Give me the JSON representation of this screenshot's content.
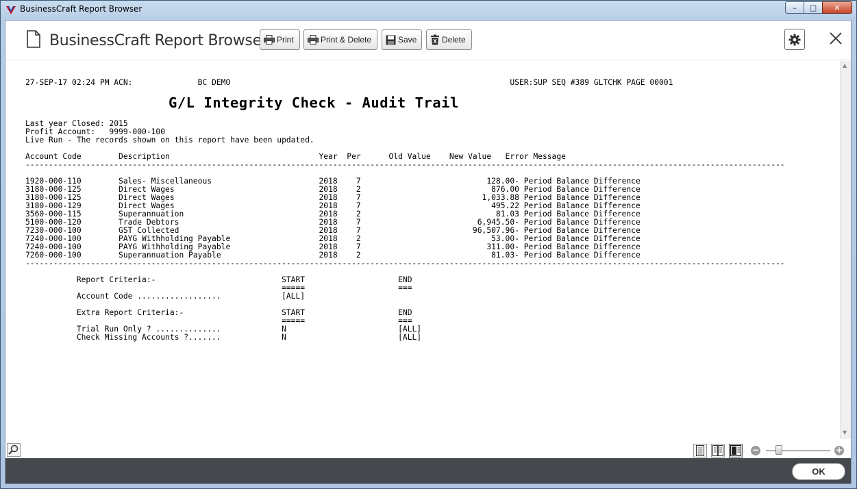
{
  "window": {
    "title": "BusinessCraft Report Browser",
    "minimize": "–",
    "maximize": "□",
    "close": "✕"
  },
  "header": {
    "title": "BusinessCraft Report Browser",
    "buttons": {
      "print": "Print",
      "print_delete": "Print & Delete",
      "save": "Save",
      "delete": "Delete"
    },
    "icons": [
      "document-icon",
      "printer-icon",
      "save-icon",
      "trash-icon",
      "gear-icon",
      "close-icon"
    ]
  },
  "report": {
    "header_line": "27-SEP-17 02:24 PM ACN:              BC DEMO                                                            USER:SUP SEQ #389 GLTCHK PAGE 00001",
    "title": "G/L Integrity Check - Audit Trail",
    "info": [
      "Last year Closed: 2015",
      "Profit Account:   9999-000-100",
      "Live Run - The records shown on this report have been updated."
    ],
    "columns": [
      "Account Code",
      "Description",
      "Year",
      "Per",
      "Old Value",
      "New Value",
      "Error Message"
    ],
    "rows": [
      [
        "1920-000-110",
        "Sales- Miscellaneous",
        "2018",
        "7",
        "",
        "128.00-",
        "Period Balance Difference"
      ],
      [
        "3180-000-125",
        "Direct Wages",
        "2018",
        "2",
        "",
        "876.00",
        "Period Balance Difference"
      ],
      [
        "3180-000-125",
        "Direct Wages",
        "2018",
        "7",
        "",
        "1,033.88",
        "Period Balance Difference"
      ],
      [
        "3180-000-129",
        "Direct Wages",
        "2018",
        "7",
        "",
        "495.22",
        "Period Balance Difference"
      ],
      [
        "3560-000-115",
        "Superannuation",
        "2018",
        "2",
        "",
        "81.03",
        "Period Balance Difference"
      ],
      [
        "5100-000-120",
        "Trade Debtors",
        "2018",
        "7",
        "",
        "6,945.50-",
        "Period Balance Difference"
      ],
      [
        "7230-000-100",
        "GST Collected",
        "2018",
        "7",
        "",
        "96,507.96-",
        "Period Balance Difference"
      ],
      [
        "7240-000-100",
        "PAYG Withholding Payable",
        "2018",
        "2",
        "",
        "53.00-",
        "Period Balance Difference"
      ],
      [
        "7240-000-100",
        "PAYG Withholding Payable",
        "2018",
        "7",
        "",
        "311.00-",
        "Period Balance Difference"
      ],
      [
        "7260-000-100",
        "Superannuation Payable",
        "2018",
        "2",
        "",
        "81.03-",
        "Period Balance Difference"
      ]
    ],
    "criteria": {
      "heading": "Report Criteria:-",
      "start": "START",
      "end": "END",
      "start_ul": "=====",
      "end_ul": "===",
      "items": [
        {
          "label": "Account Code ..................",
          "start": "[ALL]",
          "end": ""
        }
      ]
    },
    "extra_criteria": {
      "heading": "Extra Report Criteria:-",
      "start": "START",
      "end": "END",
      "start_ul": "=====",
      "end_ul": "===",
      "items": [
        {
          "label": "Trial Run Only ? ..............",
          "start": "N",
          "end": "[ALL]"
        },
        {
          "label": "Check Missing Accounts ?.......",
          "start": "N",
          "end": "[ALL]"
        }
      ]
    }
  },
  "footer": {
    "ok": "OK"
  }
}
